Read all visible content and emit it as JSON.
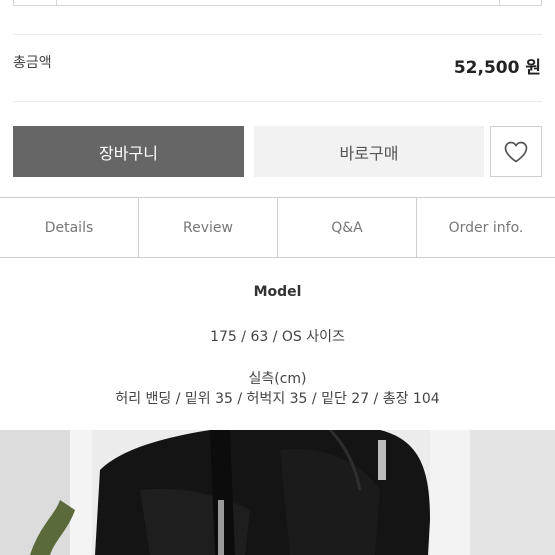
{
  "total": {
    "label": "총금액",
    "value": "52,500 원"
  },
  "buttons": {
    "cart_label": "장바구니",
    "buy_label": "바로구매",
    "wish_icon": "heart-icon"
  },
  "tabs": [
    {
      "label": "Details"
    },
    {
      "label": "Review"
    },
    {
      "label": "Q&A"
    },
    {
      "label": "Order info."
    }
  ],
  "model": {
    "title": "Model",
    "info": "175 / 63 / OS 사이즈",
    "measure_title": "실측(cm)",
    "measure_info": "허리 밴딩 / 밑위 35 / 허벅지 35 / 밑단 27 / 총장 104"
  },
  "colors": {
    "cart_bg": "#666666",
    "buy_bg": "#f2f2f2",
    "border": "#cfcfcf"
  }
}
